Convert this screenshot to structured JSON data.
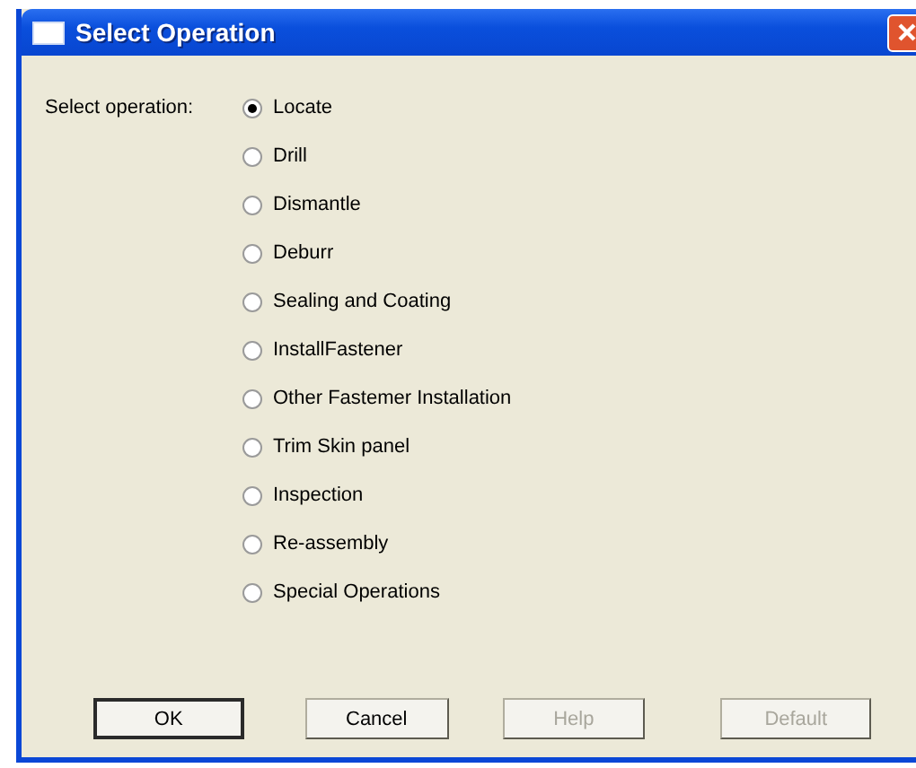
{
  "window": {
    "title": "Select Operation"
  },
  "prompt": "Select operation:",
  "options": [
    {
      "label": "Locate",
      "selected": true
    },
    {
      "label": "Drill",
      "selected": false
    },
    {
      "label": "Dismantle",
      "selected": false
    },
    {
      "label": "Deburr",
      "selected": false
    },
    {
      "label": "Sealing and Coating",
      "selected": false
    },
    {
      "label": "InstallFastener",
      "selected": false
    },
    {
      "label": "Other Fastemer Installation",
      "selected": false
    },
    {
      "label": "Trim Skin panel",
      "selected": false
    },
    {
      "label": "Inspection",
      "selected": false
    },
    {
      "label": "Re-assembly",
      "selected": false
    },
    {
      "label": "Special Operations",
      "selected": false
    }
  ],
  "buttons": [
    {
      "label": "OK",
      "default": true,
      "disabled": false
    },
    {
      "label": "Cancel",
      "default": false,
      "disabled": false
    },
    {
      "label": "Help",
      "default": false,
      "disabled": true
    },
    {
      "label": "Default",
      "default": false,
      "disabled": true
    }
  ]
}
